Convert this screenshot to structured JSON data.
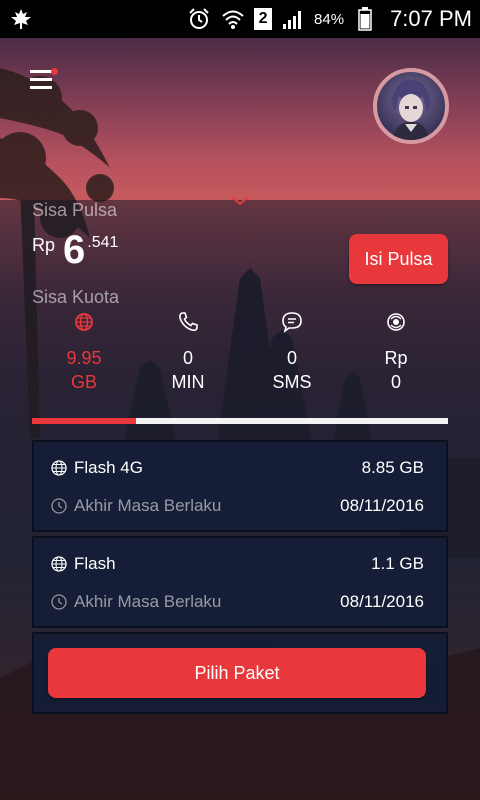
{
  "status_bar": {
    "sim_slot": "2",
    "battery_percent": "84%",
    "time": "7:07 PM"
  },
  "header": {
    "icons": {
      "menu": "menu-icon",
      "notification_dot": "red-dot"
    }
  },
  "balance": {
    "label": "Sisa Pulsa",
    "currency": "Rp",
    "integer": "6",
    "decimal": ".541",
    "topup_label": "Isi Pulsa"
  },
  "quota": {
    "label": "Sisa Kuota",
    "items": [
      {
        "icon": "globe-icon",
        "value": "9.95",
        "unit": "GB",
        "active": true
      },
      {
        "icon": "phone-icon",
        "value": "0",
        "unit": "MIN",
        "active": false
      },
      {
        "icon": "chat-icon",
        "value": "0",
        "unit": "SMS",
        "active": false
      },
      {
        "icon": "coin-icon",
        "value": "Rp",
        "unit": "0",
        "active": false
      }
    ],
    "usage_fraction": 0.25
  },
  "packages": [
    {
      "name": "Flash 4G",
      "size": "8.85 GB",
      "expiry_label": "Akhir Masa Berlaku",
      "expiry_date": "08/11/2016"
    },
    {
      "name": "Flash",
      "size": "1.1 GB",
      "expiry_label": "Akhir Masa Berlaku",
      "expiry_date": "08/11/2016"
    }
  ],
  "cta": {
    "label": "Pilih Paket"
  },
  "colors": {
    "accent": "#e8383b",
    "card": "#14203a",
    "muted_text": "#9a8f98"
  }
}
